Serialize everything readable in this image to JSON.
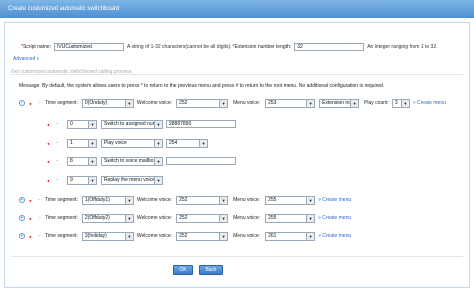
{
  "window": {
    "title": "Create customized automatic switchboard"
  },
  "form": {
    "script_name_label": "Script name:",
    "script_name_value": "IVUCustomized",
    "script_name_hint": "A string of 1-32 characters(cannot be all digits).",
    "ext_len_label": "Extension number length:",
    "ext_len_value": "32",
    "ext_len_hint": "An integer ranging from 1 to 32.",
    "advanced_link": "Advanced »"
  },
  "section": {
    "title": "Get customized automatic switchboard calling process"
  },
  "message": "Message: By default, the system allows users to press * to return to the previous menu and press # to return to the root menu. No additional configuration is required.",
  "labels": {
    "time_segment": "Time segment:",
    "welcome_voice": "Welcome voice:",
    "menu_voice": "Menu voice:",
    "play_count": "Play count:",
    "create_menu": "» Create menu"
  },
  "segments": [
    {
      "time": "0(Onduty)",
      "welcome": "252",
      "menu": "253",
      "ext": "Extension not",
      "count": "3"
    },
    {
      "time": "1(Offduty1)",
      "welcome": "252",
      "menu": "255"
    },
    {
      "time": "2(Offduty2)",
      "welcome": "252",
      "menu": "255"
    },
    {
      "time": "3(holiday)",
      "welcome": "252",
      "menu": "261"
    }
  ],
  "menu_items": [
    {
      "key": "0",
      "action": "Switch to assigned num",
      "value": "28887890"
    },
    {
      "key": "1",
      "action": "Play voice",
      "value": "254"
    },
    {
      "key": "8",
      "action": "Switch to voice mailbox",
      "value": ""
    },
    {
      "key": "9",
      "action": "Replay the menu voice",
      "value": ""
    }
  ],
  "buttons": {
    "ok": "OK",
    "back": "Back"
  }
}
